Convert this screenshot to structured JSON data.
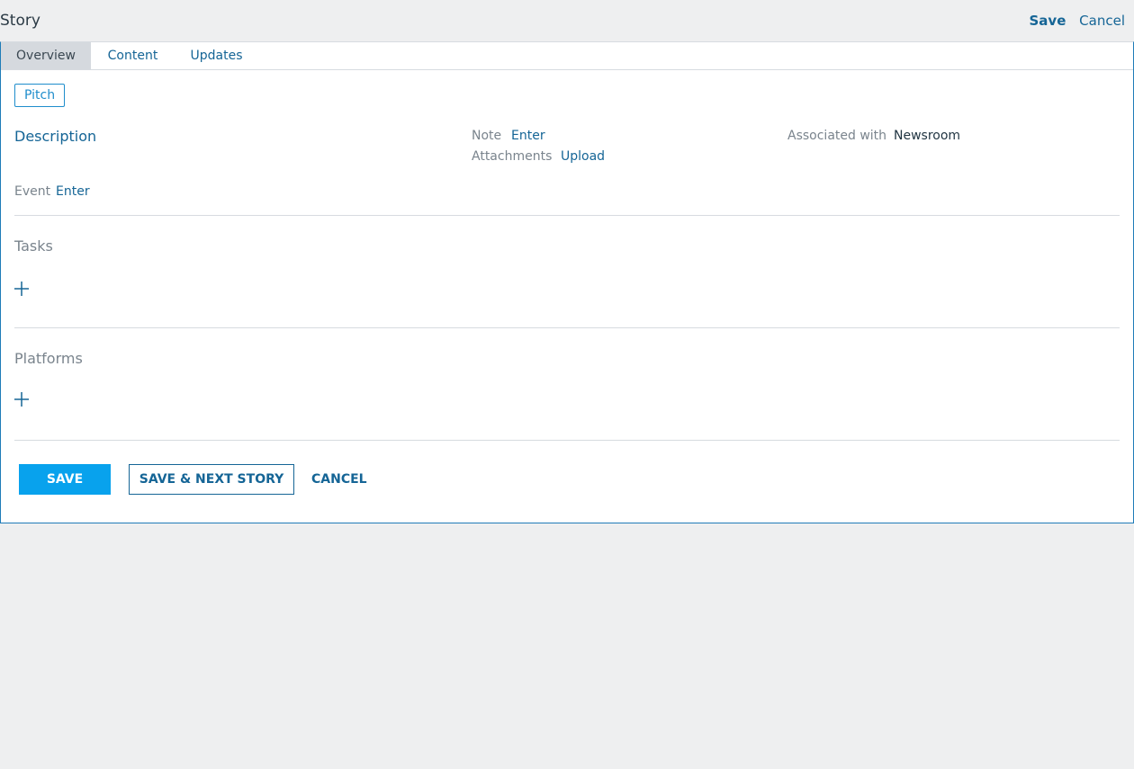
{
  "header": {
    "title": "Story",
    "save_label": "Save",
    "cancel_label": "Cancel"
  },
  "tabs": [
    {
      "label": "Overview",
      "active": true
    },
    {
      "label": "Content",
      "active": false
    },
    {
      "label": "Updates",
      "active": false
    }
  ],
  "overview": {
    "status_badge": "Pitch",
    "description_label": "Description",
    "note_label": "Note",
    "note_action": "Enter",
    "attachments_label": "Attachments",
    "attachments_action": "Upload",
    "associated_label": "Associated with",
    "associated_value": "Newsroom",
    "event_label": "Event",
    "event_action": "Enter"
  },
  "sections": {
    "tasks_title": "Tasks",
    "platforms_title": "Platforms"
  },
  "footer": {
    "save_label": "SAVE",
    "save_next_label": "SAVE & NEXT STORY",
    "cancel_label": "CANCEL"
  },
  "colors": {
    "accent": "#08a2ed",
    "link": "#156596",
    "background": "#eeeff0"
  },
  "icons": {
    "add": "plus-icon"
  }
}
